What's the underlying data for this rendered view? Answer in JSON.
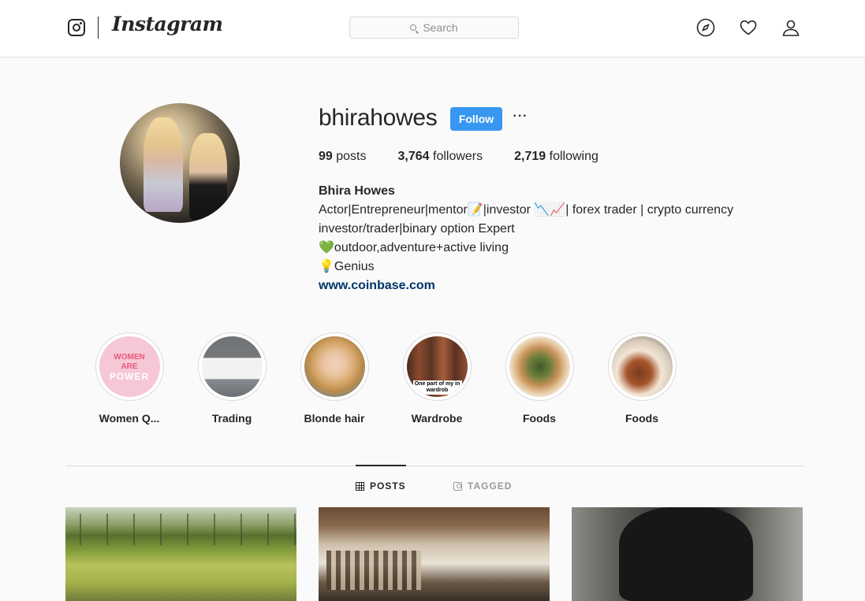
{
  "header": {
    "logo_wordmark": "Instagram",
    "search_placeholder": "Search"
  },
  "profile": {
    "username": "bhirahowes",
    "follow_label": "Follow",
    "more_label": "···",
    "stats": {
      "posts_count": "99",
      "posts_label": "posts",
      "followers_count": "3,764",
      "followers_label": "followers",
      "following_count": "2,719",
      "following_label": "following"
    },
    "bio": {
      "full_name": "Bhira Howes",
      "line1": "Actor|Entrepreneur|mentor📝|investor 📉📈| forex trader | crypto currency",
      "line2": "investor/trader|binary option Expert",
      "line3": "💚outdoor,adventure+active living",
      "line4": "💡Genius",
      "website": "www.coinbase.com"
    }
  },
  "highlights": [
    {
      "label": "Women Q..."
    },
    {
      "label": "Trading"
    },
    {
      "label": "Blonde hair"
    },
    {
      "label": "Wardrobe"
    },
    {
      "label": "Foods"
    },
    {
      "label": "Foods"
    }
  ],
  "highlight_thumb_text": {
    "women_line1": "WOMEN",
    "women_line2": "ARE",
    "women_line3": "POWER",
    "wardrobe_caption": "One part of my in wardrob"
  },
  "tabs": {
    "posts": "POSTS",
    "tagged": "TAGGED"
  },
  "colors": {
    "follow_button": "#3897f0",
    "link": "#003569",
    "border": "#dbdbdb",
    "background": "#fafafa"
  },
  "icons": {
    "nav": [
      "explore-icon",
      "heart-icon",
      "profile-icon"
    ]
  }
}
